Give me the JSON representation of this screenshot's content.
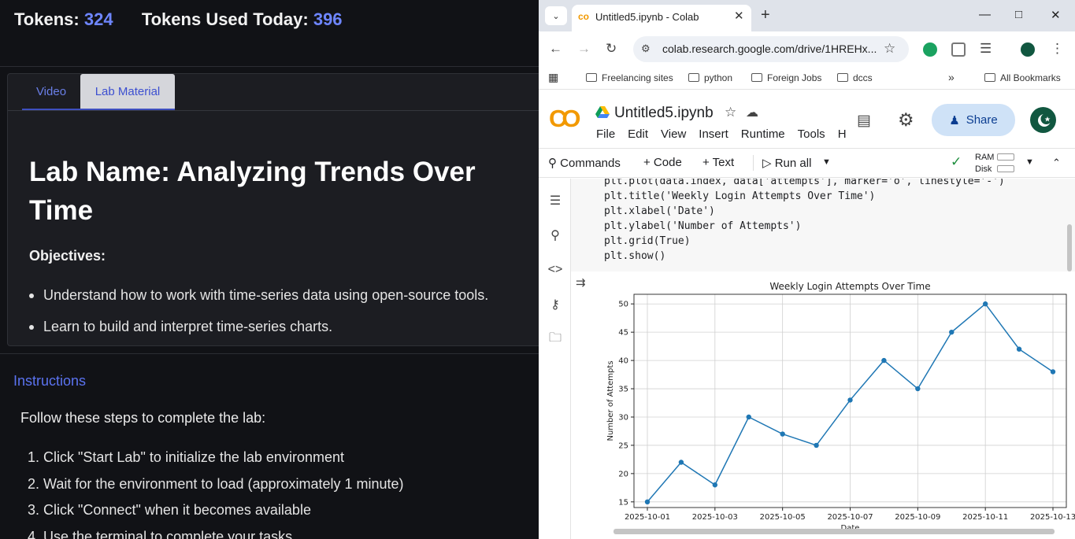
{
  "left": {
    "tokens_label": "Tokens:",
    "tokens_value": "324",
    "used_label": "Tokens Used Today:",
    "used_value": "396",
    "tabs": [
      "Video",
      "Lab Material"
    ],
    "lab_title": "Lab Name: Analyzing Trends Over Time",
    "objectives_heading": "Objectives:",
    "objectives": [
      "Understand how to work with time-series data using open-source tools.",
      "Learn to build and interpret time-series charts."
    ],
    "instructions_link": "Instructions",
    "instructions_intro": "Follow these steps to complete the lab:",
    "steps": [
      "1. Click \"Start Lab\" to initialize the lab environment",
      "2. Wait for the environment to load (approximately 1 minute)",
      "3. Click \"Connect\" when it becomes available",
      "4. Use the terminal to complete your tasks"
    ]
  },
  "browser": {
    "tab_title": "Untitled5.ipynb - Colab",
    "url": "colab.research.google.com/drive/1HREHx...",
    "bookmarks": [
      "Freelancing sites",
      "python",
      "Foreign Jobs",
      "dccs"
    ],
    "all_bookmarks": "All Bookmarks"
  },
  "colab": {
    "logo": "CO",
    "notebook_name": "Untitled5.ipynb",
    "menus": [
      "File",
      "Edit",
      "View",
      "Insert",
      "Runtime",
      "Tools",
      "H"
    ],
    "share_label": "Share",
    "toolbar": {
      "commands": "Commands",
      "code": "+ Code",
      "text": "+ Text",
      "run_all": "Run all",
      "ram": "RAM",
      "disk": "Disk"
    },
    "code_lines": [
      "plt.plot(data.index, data['attempts'], marker='o', linestyle='-')",
      "plt.title('Weekly Login Attempts Over Time')",
      "plt.xlabel('Date')",
      "plt.ylabel('Number of Attempts')",
      "plt.grid(True)",
      "plt.show()"
    ]
  },
  "chart_data": {
    "type": "line",
    "title": "Weekly Login Attempts Over Time",
    "xlabel": "Date",
    "ylabel": "Number of Attempts",
    "x": [
      "2025-10-01",
      "2025-10-02",
      "2025-10-03",
      "2025-10-04",
      "2025-10-05",
      "2025-10-06",
      "2025-10-07",
      "2025-10-08",
      "2025-10-09",
      "2025-10-10",
      "2025-10-11",
      "2025-10-12",
      "2025-10-13"
    ],
    "values": [
      15,
      22,
      18,
      30,
      27,
      25,
      33,
      40,
      35,
      45,
      50,
      42,
      38
    ],
    "x_ticks": [
      "2025-10-01",
      "2025-10-03",
      "2025-10-05",
      "2025-10-07",
      "2025-10-09",
      "2025-10-11",
      "2025-10-13"
    ],
    "y_ticks": [
      15,
      20,
      25,
      30,
      35,
      40,
      45,
      50
    ],
    "ylim": [
      14,
      51.7
    ],
    "grid": true,
    "color": "#1f77b4"
  }
}
